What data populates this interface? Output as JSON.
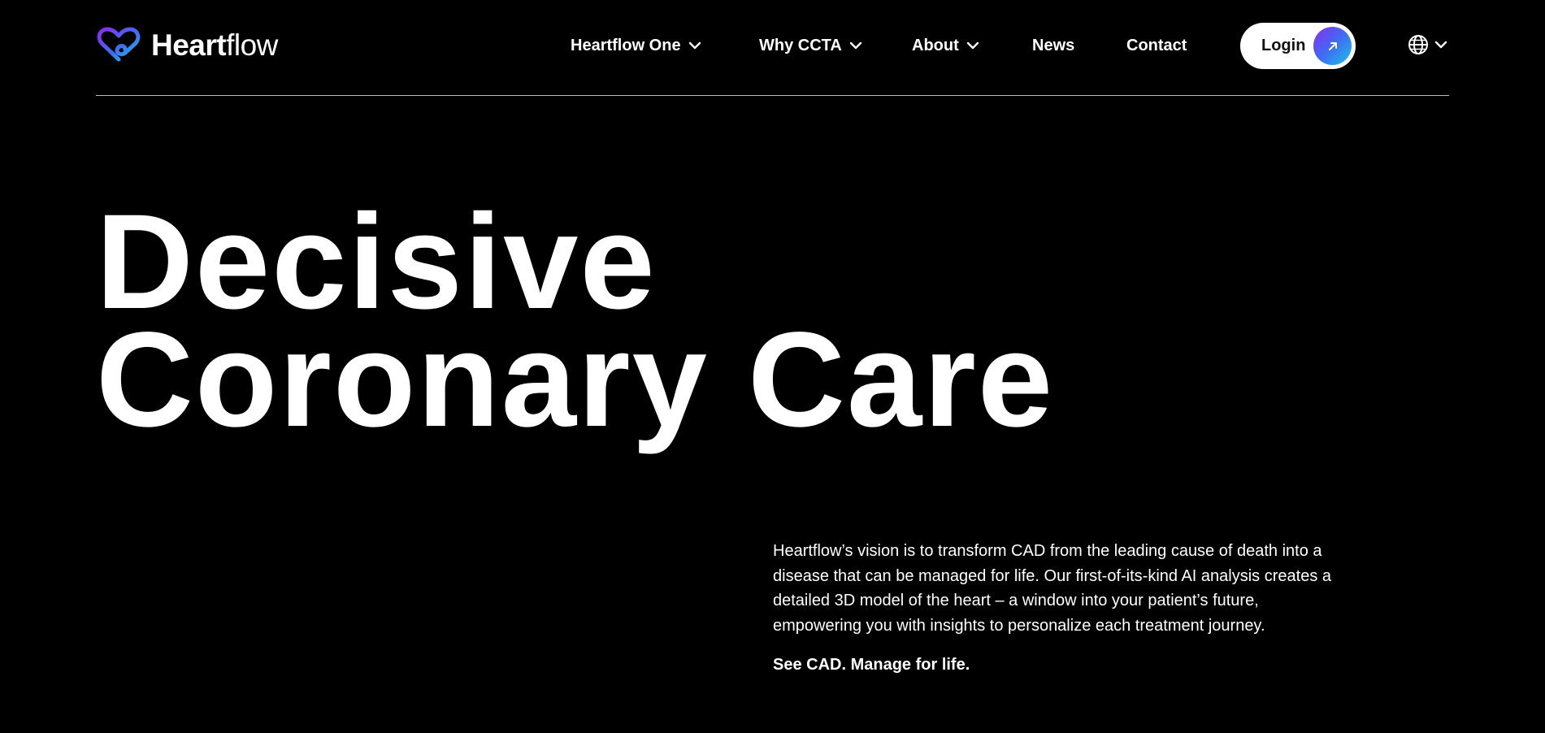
{
  "brand": {
    "name_bold": "Heart",
    "name_light": "flow",
    "gradient": [
      "#8a2cf0",
      "#3f6cf2",
      "#18c6e8"
    ]
  },
  "nav": {
    "items": [
      {
        "label": "Heartflow One",
        "has_dropdown": true
      },
      {
        "label": "Why CCTA",
        "has_dropdown": true
      },
      {
        "label": "About",
        "has_dropdown": true
      },
      {
        "label": "News",
        "has_dropdown": false
      },
      {
        "label": "Contact",
        "has_dropdown": false
      }
    ],
    "login_label": "Login",
    "login_icon": "arrow-up-right-icon",
    "language_icon": "globe-icon"
  },
  "hero": {
    "title_line1": "Decisive",
    "title_line2": "Coronary Care",
    "description": "Heartflow’s vision is to transform CAD from the leading cause of death into a disease that can be managed for life. Our first-of-its-kind AI analysis creates a detailed 3D model of the heart – a window into your patient’s future, empowering you with insights to personalize each treatment journey.",
    "tagline": "See CAD. Manage for life."
  },
  "colors": {
    "background": "#000000",
    "text": "#ffffff",
    "login_bg": "#ffffff",
    "divider": "#bdbdbd"
  }
}
